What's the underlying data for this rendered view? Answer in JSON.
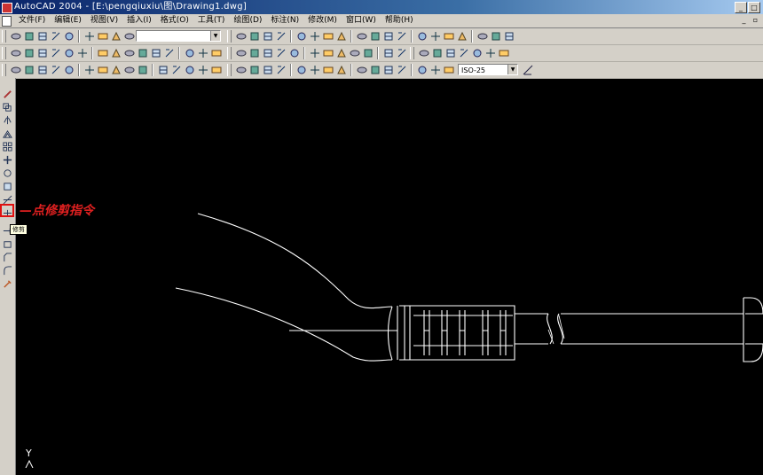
{
  "window": {
    "title": "AutoCAD 2004 - [E:\\pengqiuxiu\\图\\Drawing1.dwg]",
    "minimize_icon": "minimize-icon",
    "maximize_icon": "maximize-icon",
    "close_icon": "close-icon"
  },
  "menubar": {
    "items": [
      "文件(F)",
      "编辑(E)",
      "视图(V)",
      "插入(I)",
      "格式(O)",
      "工具(T)",
      "绘图(D)",
      "标注(N)",
      "修改(M)",
      "窗口(W)",
      "帮助(H)"
    ]
  },
  "toolbars": {
    "layer_combo_value": "",
    "dimstyle_combo_value": "ISO-25"
  },
  "left_toolbar": {
    "tooltip": "修剪"
  },
  "annotation": {
    "text": "点修剪指令",
    "color": "#e02020"
  },
  "ucs": {
    "y_label": "Y"
  },
  "colors": {
    "canvas": "#000000",
    "toolbar": "#d4d0c8",
    "titlebar": "#0a246a",
    "highlight": "#e01010"
  }
}
